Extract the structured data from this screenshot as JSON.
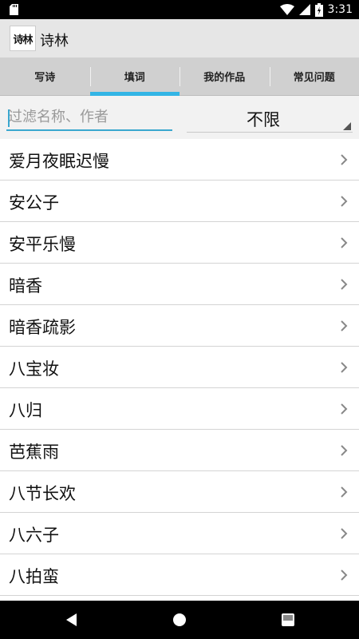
{
  "status_bar": {
    "time": "3:31",
    "icons": [
      "sd-card-icon",
      "wifi-icon",
      "signal-icon",
      "battery-icon"
    ]
  },
  "app": {
    "title": "诗林",
    "logo_text": "诗林"
  },
  "tabs": [
    {
      "label": "写诗",
      "active": false
    },
    {
      "label": "填词",
      "active": true
    },
    {
      "label": "我的作品",
      "active": false
    },
    {
      "label": "常见问题",
      "active": false
    }
  ],
  "filter": {
    "placeholder": "过滤名称、作者",
    "value": "",
    "select_value": "不限"
  },
  "list": {
    "items": [
      "爱月夜眠迟慢",
      "安公子",
      "安平乐慢",
      "暗香",
      "暗香疏影",
      "八宝妆",
      "八归",
      "芭蕉雨",
      "八节长欢",
      "八六子",
      "八拍蛮"
    ]
  },
  "colors": {
    "accent": "#33b5e5",
    "tab_bg": "#d0d0d0",
    "appbar_bg": "#e6e6e6"
  }
}
